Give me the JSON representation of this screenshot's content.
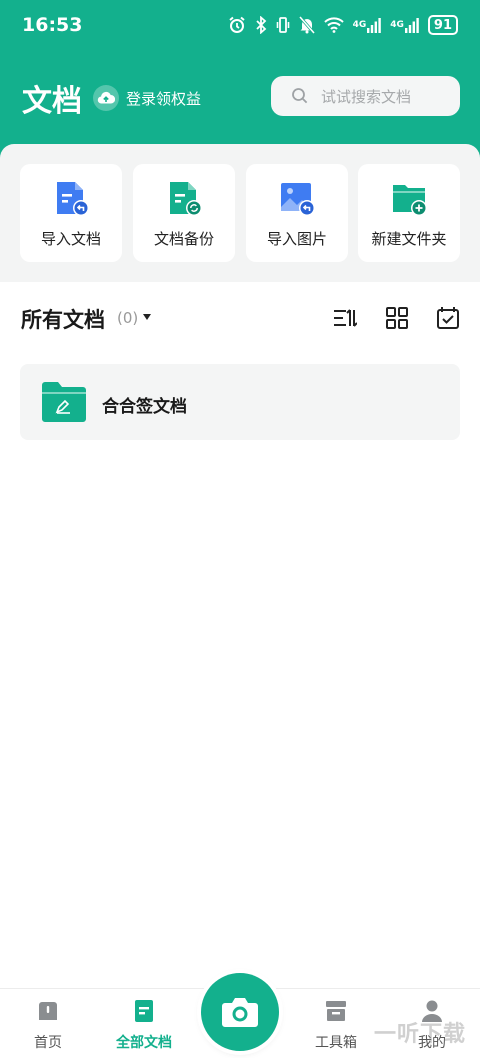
{
  "status_bar": {
    "time": "16:53",
    "network_1": "4G",
    "network_2": "4G",
    "battery": "91"
  },
  "header": {
    "title": "文档",
    "login_label": "登录领权益",
    "search_placeholder": "试试搜索文档"
  },
  "quick_actions": [
    {
      "label": "导入文档",
      "icon": "import-document-icon"
    },
    {
      "label": "文档备份",
      "icon": "document-backup-icon"
    },
    {
      "label": "导入图片",
      "icon": "import-image-icon"
    },
    {
      "label": "新建文件夹",
      "icon": "new-folder-icon"
    }
  ],
  "documents": {
    "section_title": "所有文档",
    "count": "(0)",
    "folders": [
      {
        "name": "合合签文档",
        "icon": "signature-folder-icon"
      }
    ]
  },
  "tabbar": {
    "tabs": [
      {
        "label": "首页",
        "icon": "home-icon"
      },
      {
        "label": "全部文档",
        "icon": "documents-icon"
      },
      {
        "label": "工具箱",
        "icon": "toolbox-icon"
      },
      {
        "label": "我的",
        "icon": "profile-icon"
      }
    ],
    "center_icon": "camera-icon"
  },
  "watermark": "一听下载",
  "colors": {
    "primary": "#13b08d",
    "blue": "#3f7cf2",
    "panel": "#f3f4f4"
  }
}
